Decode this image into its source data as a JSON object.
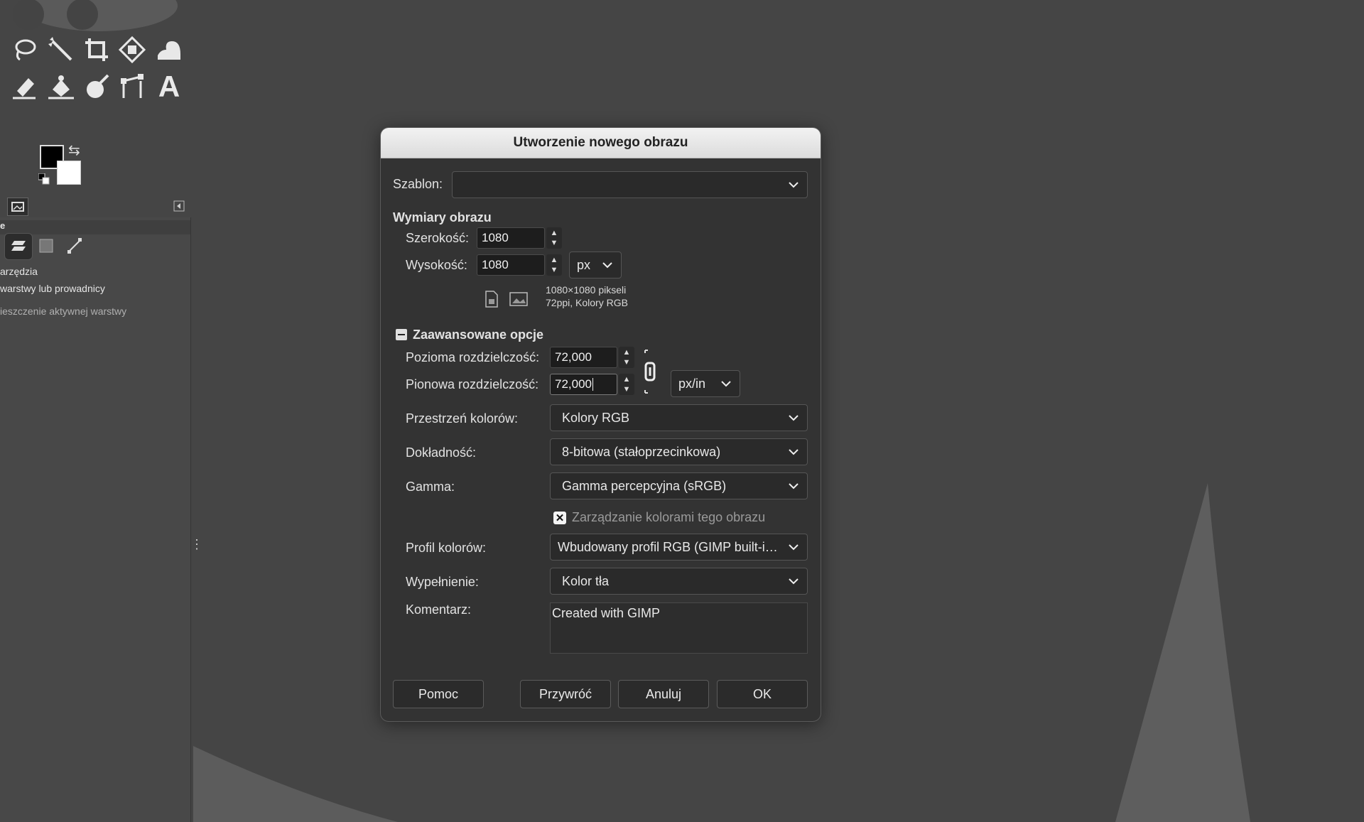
{
  "dialog": {
    "title": "Utworzenie nowego obrazu",
    "template": {
      "label": "Szablon:",
      "value": ""
    },
    "dimensions": {
      "section_label": "Wymiary obrazu",
      "width_label": "Szerokość:",
      "width_value": "1080",
      "height_label": "Wysokość:",
      "height_value": "1080",
      "unit": "px",
      "info_line1": "1080×1080 pikseli",
      "info_line2": "72ppi, Kolory RGB"
    },
    "advanced": {
      "section_label": "Zaawansowane opcje",
      "xres_label": "Pozioma rozdzielczość:",
      "xres_value": "72,000",
      "yres_label": "Pionowa rozdzielczość:",
      "yres_value": "72,000",
      "res_unit": "px/in",
      "colorspace_label": "Przestrzeń kolorów:",
      "colorspace_value": "Kolory RGB",
      "precision_label": "Dokładność:",
      "precision_value": "8-bitowa (stałoprzecinkowa)",
      "gamma_label": "Gamma:",
      "gamma_value": "Gamma percepcyjna (sRGB)",
      "color_manage_label": "Zarządzanie kolorami tego obrazu",
      "color_manage_checked": true,
      "profile_label": "Profil kolorów:",
      "profile_value": "Wbudowany profil RGB (GIMP built-i…",
      "fill_label": "Wypełnienie:",
      "fill_value": "Kolor tła",
      "comment_label": "Komentarz:",
      "comment_value": "Created with GIMP"
    },
    "buttons": {
      "help": "Pomoc",
      "reset": "Przywróć",
      "cancel": "Anuluj",
      "ok": "OK"
    }
  },
  "toolbox": {
    "tools_row1": [
      "free-select-icon",
      "fuzzy-select-icon",
      "crop-icon",
      "unified-transform-icon",
      "warp-transform-icon"
    ],
    "tools_row2": [
      "eraser-icon",
      "bucket-fill-icon",
      "smudge-icon",
      "paths-icon",
      "text-tool-icon"
    ],
    "text_tool_glyph": "A",
    "fg_color": "#000000",
    "bg_color": "#ffffff"
  },
  "tool_options": {
    "header_fragment": "e",
    "line1": "arzędzia",
    "line2": "warstwy lub prowadnicy",
    "line3": "ieszczenie aktywnej warstwy"
  },
  "colors": {
    "canvas_bg": "#454545",
    "dialog_bg": "#333333",
    "titlebar_text": "#222222"
  }
}
